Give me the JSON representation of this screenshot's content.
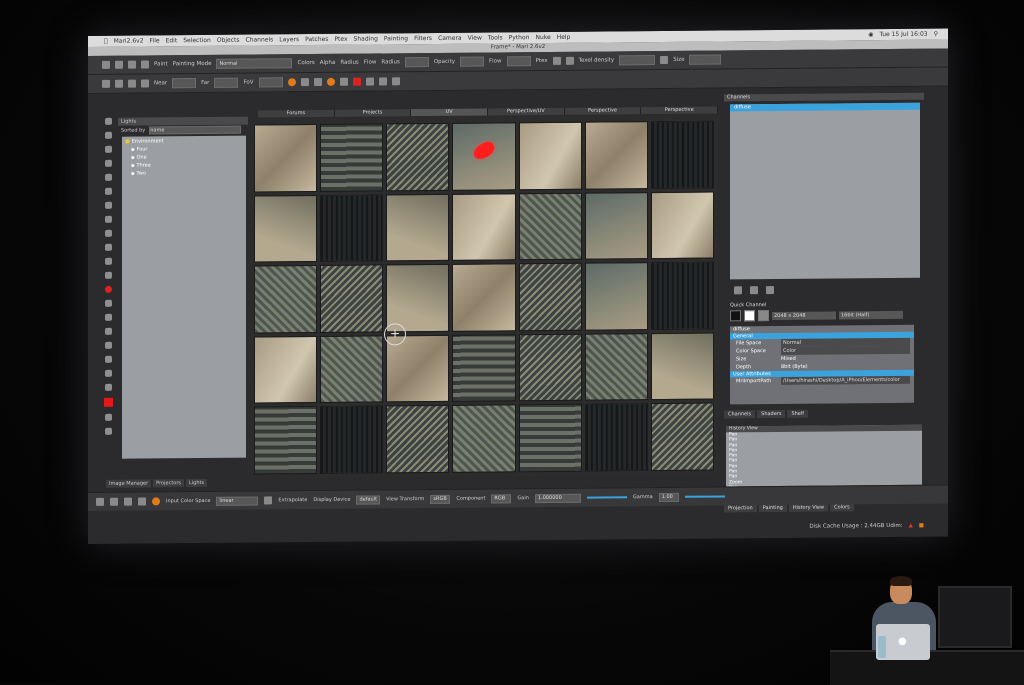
{
  "menubar": {
    "apple": "",
    "app": "Mari2.6v2",
    "items": [
      "File",
      "Edit",
      "Selection",
      "Objects",
      "Channels",
      "Layers",
      "Patches",
      "Ptex",
      "Shading",
      "Painting",
      "Filters",
      "Camera",
      "View",
      "Tools",
      "Python",
      "Nuke",
      "Help"
    ],
    "clock": "Tue 15 Jul  16:03"
  },
  "window_title": "Frame* - Mari 2.6v2",
  "toolbar1": {
    "paint": "Paint",
    "painting_mode_label": "Painting Mode",
    "painting_mode": "Normal",
    "colors": "Colors",
    "alpha": "Alpha",
    "radius": "Radius",
    "flow": "Flow",
    "radius2": "Radius",
    "opacity": "Opacity",
    "flow2": "Flow",
    "ptex": "Ptex",
    "texel_density": "Texel density",
    "size": "Size"
  },
  "toolbar2": {
    "near": "Near",
    "far": "Far",
    "fov": "FoV"
  },
  "lights_panel": {
    "header": "Lights",
    "sorted_by_label": "Sorted by",
    "sorted_by": "name",
    "tree": [
      "Environment",
      "Four",
      "One",
      "Three",
      "Two"
    ]
  },
  "left_tabs": [
    "Image Manager",
    "Projectors",
    "Lights"
  ],
  "view_tabs": [
    "Forums",
    "Projects",
    "UV",
    "Perspective/UV",
    "Perspective",
    "Perspective"
  ],
  "channels_panel": {
    "header": "Channels",
    "selected": "diffuse"
  },
  "quick_channel": {
    "label": "Quick Channel",
    "size": "2048 x 2048",
    "depth": "16bit (Half)"
  },
  "attributes": {
    "title": "diffuse",
    "section_general": "General",
    "file_space_label": "File Space",
    "file_space": "Normal",
    "color_space_label": "Color Space",
    "color_space": "Color",
    "size_label": "Size",
    "size": "Mixed",
    "depth_label": "Depth",
    "depth": "8bit (Byte)",
    "section_user": "User Attributes",
    "import_path_label": "MriImportPath",
    "import_path": "/Users/hirashi/Desktop/A_iPhoo/Elements/color"
  },
  "right_tabs": [
    "Channels",
    "Shaders",
    "Shelf"
  ],
  "history": {
    "header": "History View",
    "items": [
      "Pan",
      "Pan",
      "Pan",
      "Pan",
      "Pan",
      "Pan",
      "Pan",
      "Pan",
      "Pan",
      "Zoom",
      "Pan",
      "Zoom"
    ]
  },
  "history_tabs": [
    "Projection",
    "Painting",
    "History View",
    "Colors"
  ],
  "bottom": {
    "input_color_space_label": "Input Color Space",
    "input_color_space": "linear",
    "extrapolate": "Extrapolate",
    "display_device_label": "Display Device",
    "display_device": "default",
    "view_transform_label": "View Transform",
    "view_transform": "sRGB",
    "component_label": "Component",
    "component": "RGB",
    "gain_label": "Gain",
    "gain": "1.000000",
    "gamma_label": "Gamma",
    "gamma": "1.00"
  },
  "status": {
    "disk_cache": "Disk Cache Usage : 2.44GB  Udim:"
  }
}
